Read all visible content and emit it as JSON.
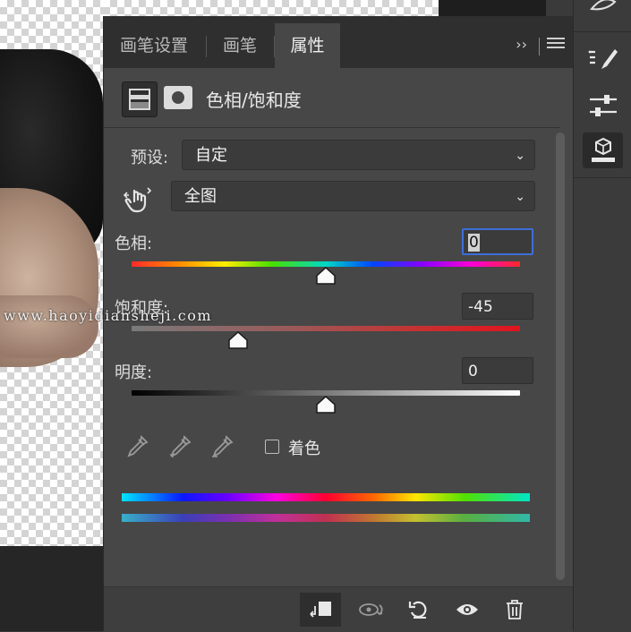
{
  "tabs": [
    {
      "label": "画笔设置",
      "active": false
    },
    {
      "label": "画笔",
      "active": false
    },
    {
      "label": "属性",
      "active": true
    }
  ],
  "tab_controls": {
    "collapse_glyph": "››"
  },
  "adjustment": {
    "title": "色相/饱和度"
  },
  "preset": {
    "label": "预设:",
    "value": "自定"
  },
  "range": {
    "value": "全图"
  },
  "hue": {
    "label": "色相:",
    "value": "0",
    "slider_fraction": 0.5
  },
  "saturation": {
    "label": "饱和度:",
    "value": "-45",
    "slider_fraction": 0.275
  },
  "lightness": {
    "label": "明度:",
    "value": "0",
    "slider_fraction": 0.5
  },
  "colorize": {
    "label": "着色",
    "checked": false
  },
  "watermark": "www.haoyidiansheji.com",
  "icons": {
    "tab_menu": "hamburger-menu-icon",
    "target_adjust": "hand-target-icon",
    "eyedropper": "eyedropper-icon",
    "eyedropper_add": "eyedropper-plus-icon",
    "eyedropper_subtract": "eyedropper-minus-icon",
    "clip": "clip-to-layer-icon",
    "view_previous": "view-previous-state-icon",
    "reset": "reset-icon",
    "visibility": "eye-icon",
    "delete": "trash-icon",
    "right_tools": [
      "brush-library-icon",
      "brush-settings-icon",
      "adjustment-sliders-icon",
      "properties-panel-icon"
    ]
  },
  "colors": {
    "panel_bg": "#474747",
    "tabbar_bg": "#2f2f2f",
    "focus_blue": "#3d6fd8",
    "saturation_track_end": "#e1141e"
  }
}
